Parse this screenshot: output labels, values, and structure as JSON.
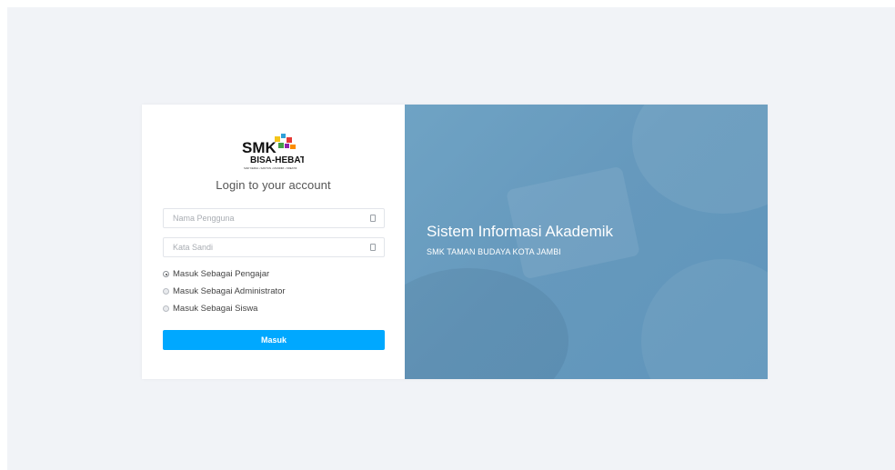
{
  "login": {
    "logo": {
      "line1": "SMK",
      "line2": "BISA-HEBAT",
      "tagline": "SIAP KERJA • SANTUN • MANDIRI • KREATIF"
    },
    "title": "Login to your account",
    "username": {
      "placeholder": "Nama Pengguna",
      "value": ""
    },
    "password": {
      "placeholder": "Kata Sandi",
      "value": ""
    },
    "roles": [
      {
        "label": "Masuk Sebagai Pengajar",
        "checked": true
      },
      {
        "label": "Masuk Sebagai Administrator",
        "checked": false
      },
      {
        "label": "Masuk Sebagai Siswa",
        "checked": false
      }
    ],
    "submit_label": "Masuk"
  },
  "hero": {
    "title": "Sistem Informasi Akademik",
    "subtitle": "SMK TAMAN BUDAYA KOTA JAMBI"
  },
  "colors": {
    "accent": "#00a8ff",
    "hero_bg": "#6a9ec1",
    "page_bg": "#f1f3f7"
  }
}
